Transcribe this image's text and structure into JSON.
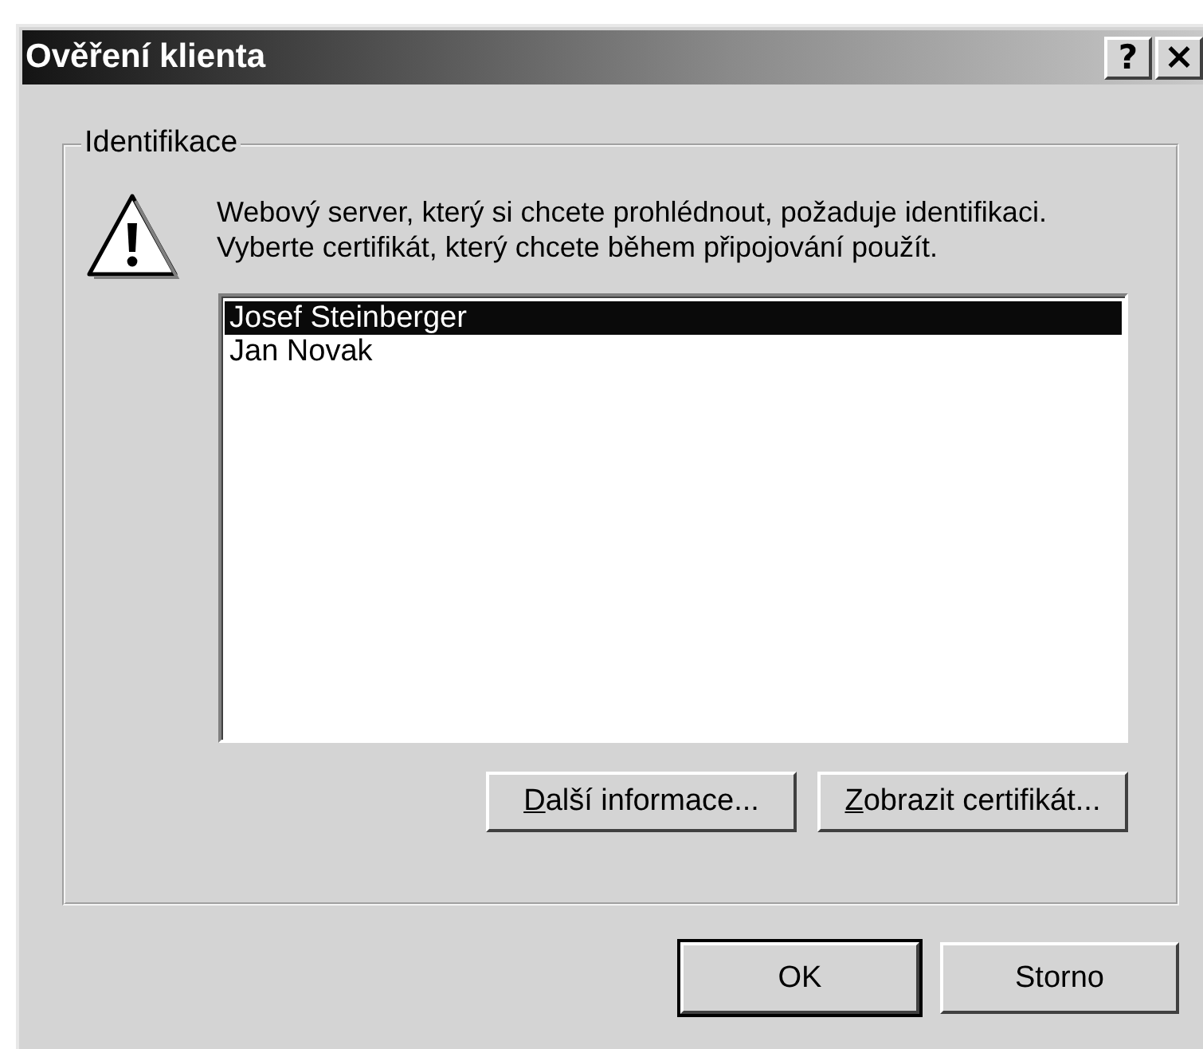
{
  "window": {
    "title": "Ověření klienta",
    "title_buttons": [
      {
        "kind": "help",
        "label": "?"
      },
      {
        "kind": "close",
        "label": "×"
      }
    ]
  },
  "group": {
    "title": "Identifikace",
    "message": "Webový server, který si chcete prohlédnout, požaduje identifikaci. Vyberte certifikát, který chcete během připojování použít.",
    "certificates": [
      {
        "name": "Josef Steinberger",
        "selected": true
      },
      {
        "name": "Jan Novak",
        "selected": false
      }
    ],
    "buttons": [
      {
        "key": "D",
        "rest": "alší informace..."
      },
      {
        "key": "Z",
        "rest": "obrazit certifikát..."
      }
    ]
  },
  "buttons": [
    {
      "label": "OK",
      "default": true
    },
    {
      "label": "Storno",
      "default": false
    }
  ]
}
